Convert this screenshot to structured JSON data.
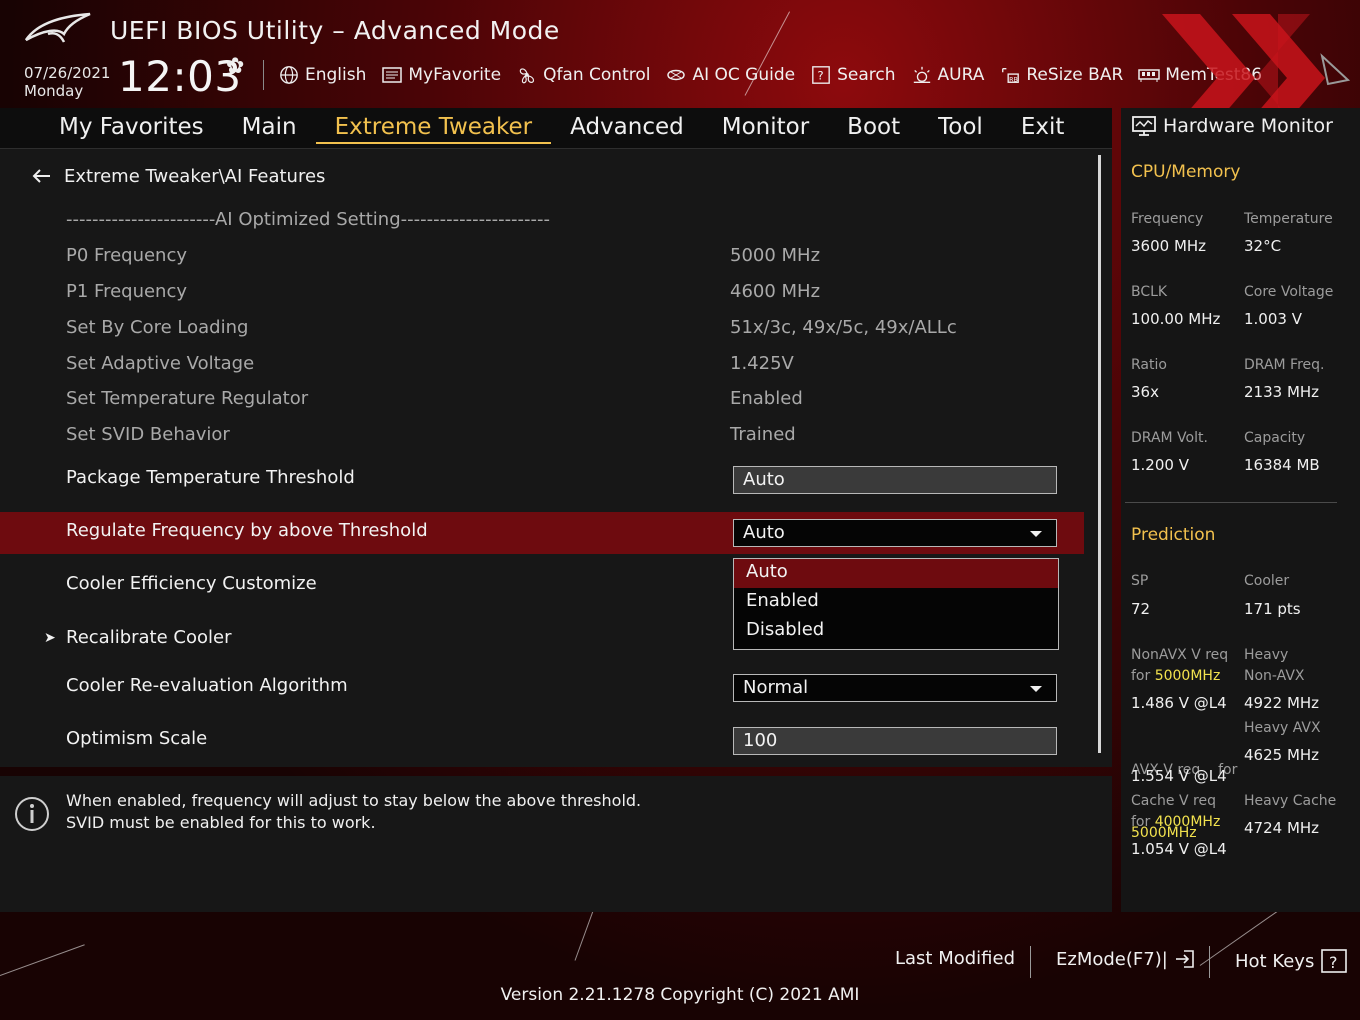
{
  "header": {
    "title": "UEFI BIOS Utility – Advanced Mode",
    "date": "07/26/2021",
    "day": "Monday",
    "time": "12:03",
    "toolbar": [
      "English",
      "MyFavorite",
      "Qfan Control",
      "AI OC Guide",
      "Search",
      "AURA",
      "ReSize BAR",
      "MemTest86"
    ]
  },
  "tabs": [
    "My Favorites",
    "Main",
    "Extreme Tweaker",
    "Advanced",
    "Monitor",
    "Boot",
    "Tool",
    "Exit"
  ],
  "active_tab": "Extreme Tweaker",
  "breadcrumb": "Extreme Tweaker\\AI Features",
  "settings": {
    "section_header": "-----------------------AI Optimized Setting-----------------------",
    "p0_label": "P0 Frequency",
    "p0_value": "5000 MHz",
    "p1_label": "P1 Frequency",
    "p1_value": "4600 MHz",
    "core_label": "Set By Core Loading",
    "core_value": "51x/3c, 49x/5c, 49x/ALLc",
    "volt_label": "Set Adaptive Voltage",
    "volt_value": "1.425V",
    "temp_label": "Set Temperature Regulator",
    "temp_value": "Enabled",
    "svid_label": "Set SVID Behavior",
    "svid_value": "Trained",
    "pkg_label": "Package Temperature Threshold",
    "pkg_value": "Auto",
    "reg_label": "Regulate Frequency by above Threshold",
    "reg_value": "Auto",
    "cooler_eff_label": "Cooler Efficiency Customize",
    "recal_label": "Recalibrate Cooler",
    "reeval_label": "Cooler Re-evaluation Algorithm",
    "reeval_value": "Normal",
    "optimism_label": "Optimism Scale",
    "optimism_value": "100"
  },
  "dropdown_options": [
    "Auto",
    "Enabled",
    "Disabled"
  ],
  "help": {
    "line1": "When enabled, frequency will adjust to stay below the above threshold.",
    "line2": "SVID must be enabled for this to work."
  },
  "monitor": {
    "title": "Hardware Monitor",
    "cpu_section": "CPU/Memory",
    "freq_l": "Frequency",
    "freq_v": "3600 MHz",
    "temp_l": "Temperature",
    "temp_v": "32°C",
    "bclk_l": "BCLK",
    "bclk_v": "100.00 MHz",
    "cv_l": "Core Voltage",
    "cv_v": "1.003 V",
    "ratio_l": "Ratio",
    "ratio_v": "36x",
    "dramf_l": "DRAM Freq.",
    "dramf_v": "2133 MHz",
    "dramv_l": "DRAM Volt.",
    "dramv_v": "1.200 V",
    "cap_l": "Capacity",
    "cap_v": "16384 MB",
    "pred_section": "Prediction",
    "sp_l": "SP",
    "sp_v": "72",
    "cooler_l": "Cooler",
    "cooler_v": "171 pts",
    "nonavx_l1": "NonAVX V req",
    "nonavx_for": "for ",
    "nonavx_freq": "5000MHz",
    "nonavx_v": "1.486 V @L4",
    "heavy_l1": "Heavy",
    "heavy_l2": "Non-AVX",
    "heavy_v": "4922 MHz",
    "avx_l1": "AVX V req    for",
    "avx_freq": "5000MHz",
    "avx_v": "1.554 V @L4",
    "havx_l": "Heavy AVX",
    "havx_v": "4625 MHz",
    "cache_l1": "Cache V req",
    "cache_for": "for ",
    "cache_freq": "4000MHz",
    "cache_v": "1.054 V @L4",
    "hcache_l": "Heavy Cache",
    "hcache_v": "4724 MHz"
  },
  "footer": {
    "last_modified": "Last Modified",
    "ezmode": "EzMode(F7)|",
    "hotkeys": "Hot Keys",
    "version": "Version 2.21.1278 Copyright (C) 2021 AMI"
  },
  "colors": {
    "accent": "#f2c14e",
    "highlight": "#6e0b0f",
    "value_yellow": "#f2e24e"
  }
}
